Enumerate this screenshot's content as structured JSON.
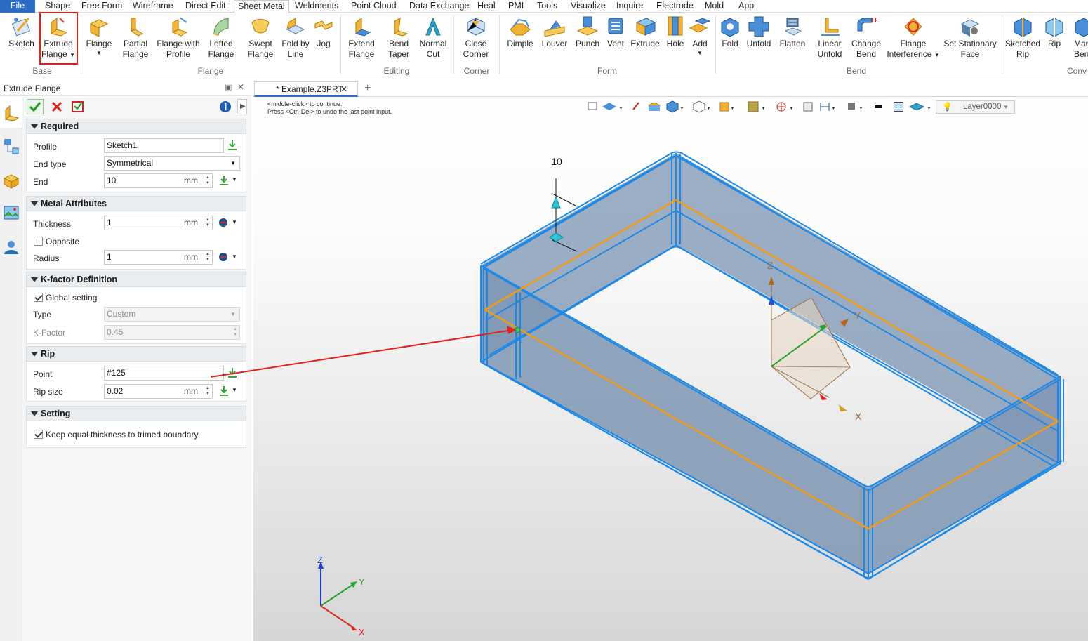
{
  "menu": {
    "tabs": [
      "File",
      "Shape",
      "Free Form",
      "Wireframe",
      "Direct Edit",
      "Sheet Metal",
      "Weldments",
      "Point Cloud",
      "Data Exchange",
      "Heal",
      "PMI",
      "Tools",
      "Visualize",
      "Inquire",
      "Electrode",
      "Mold",
      "App"
    ],
    "active_tab": "Sheet Metal"
  },
  "ribbon": {
    "buttons": {
      "sketch": [
        "Sketch"
      ],
      "extrude_flange": [
        "Extrude",
        "Flange"
      ],
      "flange": [
        "Flange"
      ],
      "partial_flange": [
        "Partial",
        "Flange"
      ],
      "flange_with_profile": [
        "Flange with",
        "Profile"
      ],
      "lofted_flange": [
        "Lofted",
        "Flange"
      ],
      "swept_flange": [
        "Swept",
        "Flange"
      ],
      "fold_by_line": [
        "Fold by",
        "Line"
      ],
      "jog": [
        "Jog"
      ],
      "extend_flange": [
        "Extend",
        "Flange"
      ],
      "bend_taper": [
        "Bend",
        "Taper"
      ],
      "normal_cut": [
        "Normal",
        "Cut"
      ],
      "close_corner": [
        "Close",
        "Corner"
      ],
      "dimple": [
        "Dimple"
      ],
      "louver": [
        "Louver"
      ],
      "punch": [
        "Punch"
      ],
      "vent": [
        "Vent"
      ],
      "extrude": [
        "Extrude"
      ],
      "hole": [
        "Hole"
      ],
      "add": [
        "Add"
      ],
      "fold": [
        "Fold"
      ],
      "unfold": [
        "Unfold"
      ],
      "flatten": [
        "Flatten"
      ],
      "linear_unfold": [
        "Linear",
        "Unfold"
      ],
      "change_bend": [
        "Change",
        "Bend"
      ],
      "flange_interference": [
        "Flange",
        "Interference"
      ],
      "set_stationary_face": [
        "Set Stationary",
        "Face"
      ],
      "sketched_rip": [
        "Sketched",
        "Rip"
      ],
      "rip": [
        "Rip"
      ],
      "mar": [
        "Mar",
        "Ben"
      ]
    },
    "groups": {
      "base": "Base",
      "flange": "Flange",
      "editing": "Editing",
      "corner": "Corner",
      "form": "Form",
      "bend": "Bend",
      "conv": "Conv"
    }
  },
  "panel": {
    "title": "Extrude Flange",
    "sections": {
      "required": "Required",
      "metal": "Metal Attributes",
      "kfactor": "K-factor Definition",
      "rip": "Rip",
      "setting": "Setting"
    },
    "fields": {
      "profile": {
        "label": "Profile",
        "value": "Sketch1"
      },
      "end_type": {
        "label": "End type",
        "value": "Symmetrical"
      },
      "end": {
        "label": "End",
        "value": "10",
        "unit": "mm"
      },
      "thickness": {
        "label": "Thickness",
        "value": "1",
        "unit": "mm"
      },
      "opposite": {
        "label": "Opposite",
        "checked": false
      },
      "radius": {
        "label": "Radius",
        "value": "1",
        "unit": "mm"
      },
      "global_setting": {
        "label": "Global setting",
        "checked": true
      },
      "type": {
        "label": "Type",
        "value": "Custom"
      },
      "kfactor": {
        "label": "K-Factor",
        "value": "0.45"
      },
      "point": {
        "label": "Point",
        "value": "#125"
      },
      "rip_size": {
        "label": "Rip size",
        "value": "0.02",
        "unit": "mm"
      },
      "keep_equal": {
        "label": "Keep equal thickness to trimed boundary",
        "checked": true
      }
    }
  },
  "document": {
    "tab": "* Example.Z3PRT",
    "hint_line1": "<middle-click> to continue.",
    "hint_line2": "Press <Ctrl-Del> to undo the last point input.",
    "layer": "Layer0000"
  },
  "viewport": {
    "dimension_label": "10",
    "axis_labels": {
      "x": "X",
      "y": "Y",
      "z": "Z"
    },
    "colors": {
      "edge": "#1e88e5",
      "face": "#7f97b5",
      "bend_line": "#f39c12",
      "callout": "#e3211b"
    }
  }
}
